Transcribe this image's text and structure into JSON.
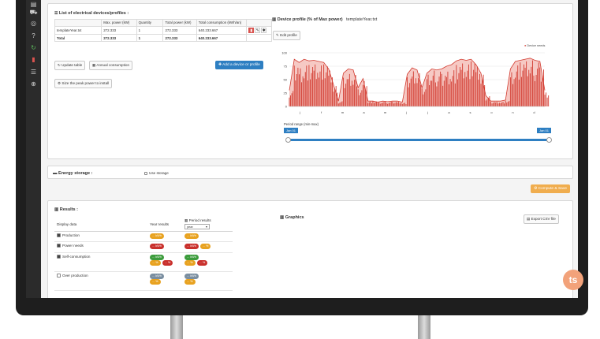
{
  "devices": {
    "title": "List of electrical devices/profiles :",
    "headers": [
      "Max. power (kW)",
      "Quantity",
      "Total power (kW)",
      "Total consumption (kWh/an)"
    ],
    "rows": [
      {
        "name": "templateYear.txt",
        "max_power": "272.333",
        "quantity": "1",
        "total_power": "272.333",
        "total_consumption": "640.233.667"
      },
      {
        "name": "Total",
        "max_power": "272.333",
        "quantity": "1",
        "total_power": "272.333",
        "total_consumption": "640.233.667"
      }
    ],
    "update_label": "Update table",
    "annual_label": "Annual consumption",
    "add_label": "Add a device or profile",
    "peak_label": "Size the peak power to install"
  },
  "profile": {
    "title": "Device profile (% of Max power)",
    "file": "templateYear.txt",
    "edit_label": "Edit profile",
    "legend": "Device needs",
    "period_label": "Period range (min-max)",
    "range_start": "Jan 01",
    "range_end": "Jan 01"
  },
  "chart_data": {
    "type": "area",
    "title": "",
    "xlabel": "",
    "ylabel": "",
    "ylim": [
      0,
      100
    ],
    "y_ticks": [
      "100",
      "75",
      "50",
      "25",
      "0"
    ],
    "x_ticks": [
      "j",
      "f",
      "m",
      "a",
      "m",
      "j",
      "j",
      "a",
      "s",
      "o",
      "n",
      "d"
    ],
    "series": [
      {
        "name": "Device needs",
        "values": [
          30,
          88,
          82,
          88,
          85,
          86,
          84,
          82,
          70,
          40,
          10,
          62,
          70,
          68,
          35,
          52,
          10,
          10,
          8,
          10,
          9,
          10,
          10,
          8,
          60,
          72,
          68,
          35,
          62,
          70,
          68,
          70,
          75,
          78,
          85,
          88,
          86,
          88,
          78,
          62,
          20,
          10,
          10,
          10,
          12,
          70,
          84,
          86,
          88,
          90,
          86,
          84,
          30
        ]
      }
    ],
    "legend_position": "top-right"
  },
  "storage": {
    "title": "Energy storage :",
    "use_label": "Use storage"
  },
  "compute_label": "Compute & Save",
  "results": {
    "title": "Results :",
    "graphics_label": "Graphics",
    "export_label": "Export CSV file",
    "col_display": "Display data",
    "col_year": "Year results",
    "col_period": "Period results",
    "period_select": "year",
    "rows": [
      {
        "label": "Production",
        "checked": true,
        "year": [
          "... kWh"
        ],
        "period": [
          "... kWh"
        ]
      },
      {
        "label": "Power needs",
        "checked": true,
        "year": [
          "... kWh"
        ],
        "period": [
          "... kWh",
          "... %"
        ]
      },
      {
        "label": "Self-consumption",
        "checked": true,
        "year": [
          "... kWh",
          "... %",
          "... %"
        ],
        "period": [
          "... kWh",
          "... %",
          "... %"
        ]
      },
      {
        "label": "Over production",
        "checked": false,
        "year": [
          "... kWh",
          "... %"
        ],
        "period": [
          "... kWh",
          "... %"
        ]
      }
    ]
  },
  "badge": "ts",
  "colors": {
    "accent_blue": "#2e7fc2",
    "chart_red": "#d23a2f",
    "chart_fill": "#f6c9c4",
    "orange": "#f0ad4e"
  }
}
